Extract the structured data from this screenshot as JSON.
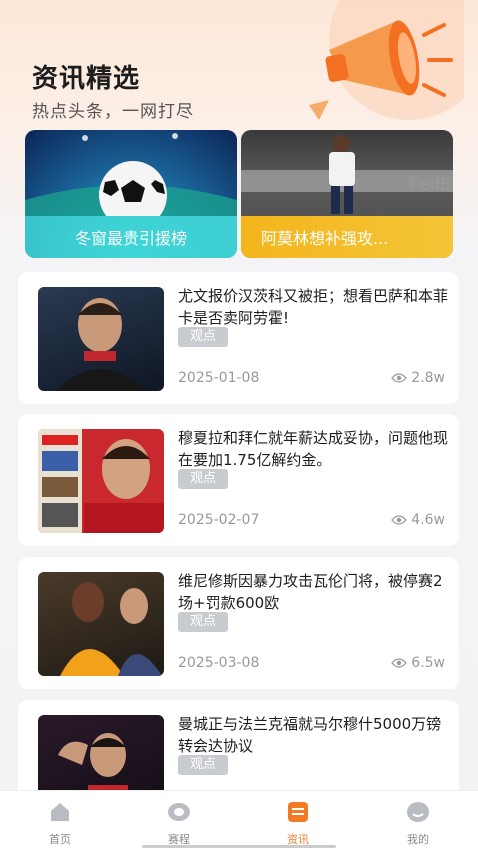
{
  "header": {
    "title": "资讯精选",
    "subtitle": "热点头条，一网打尽"
  },
  "banners": [
    {
      "caption": "冬窗最贵引援榜"
    },
    {
      "caption": "阿莫林想补强攻..."
    }
  ],
  "news": [
    {
      "headline": "尤文报价汉茨科又被拒；想看巴萨和本菲卡是否卖阿劳霍!",
      "tag": "观点",
      "date": "2025-01-08",
      "views": "2.8w"
    },
    {
      "headline": "穆夏拉和拜仁就年薪达成妥协，问题他现在要加1.75亿解约金。",
      "tag": "观点",
      "date": "2025-02-07",
      "views": "4.6w"
    },
    {
      "headline": "维尼修斯因暴力攻击瓦伦门将，被停赛2场+罚款600欧",
      "tag": "观点",
      "date": "2025-03-08",
      "views": "6.5w"
    },
    {
      "headline": "曼城正与法兰克福就马尔穆什5000万镑转会达协议",
      "tag": "观点",
      "date": "",
      "views": ""
    }
  ],
  "tabbar": [
    {
      "label": "首页",
      "icon": "home-icon"
    },
    {
      "label": "赛程",
      "icon": "schedule-icon"
    },
    {
      "label": "资讯",
      "icon": "news-icon"
    },
    {
      "label": "我的",
      "icon": "profile-icon"
    }
  ],
  "colors": {
    "accent": "#f37b24",
    "tag_bg": "#c8cbd0"
  }
}
